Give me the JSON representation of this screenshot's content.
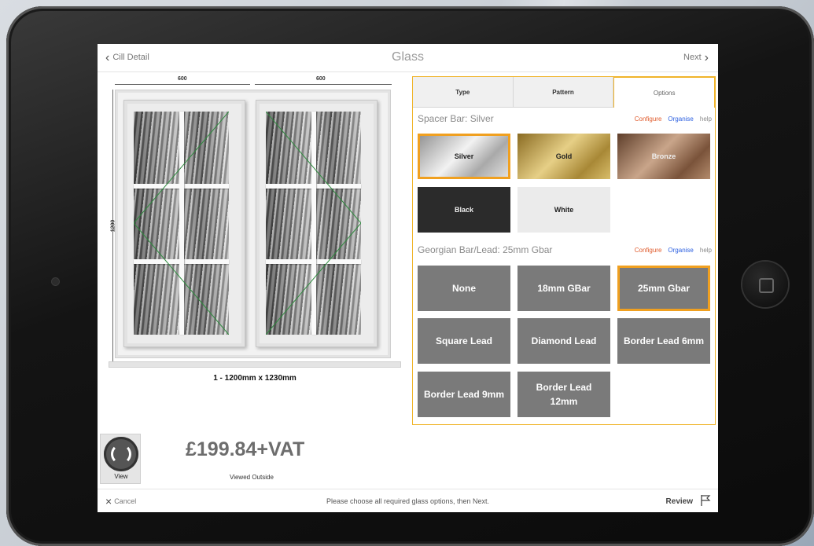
{
  "header": {
    "back_label": "Cill Detail",
    "title": "Glass",
    "next_label": "Next"
  },
  "drawing": {
    "width_left": "600",
    "width_right": "600",
    "height": "1200",
    "size_label": "1 - 1200mm x 1230mm"
  },
  "tabs": [
    {
      "label": "Type"
    },
    {
      "label": "Pattern"
    },
    {
      "label": "Options"
    }
  ],
  "active_tab": "Options",
  "spacer": {
    "title": "Spacer Bar: Silver",
    "configure": "Configure",
    "organise": "Organise",
    "help": "help",
    "options": [
      {
        "label": "Silver",
        "selected": true
      },
      {
        "label": "Gold",
        "selected": false
      },
      {
        "label": "Bronze",
        "selected": false
      },
      {
        "label": "Black",
        "selected": false
      },
      {
        "label": "White",
        "selected": false
      }
    ]
  },
  "georgian": {
    "title": "Georgian Bar/Lead: 25mm Gbar",
    "configure": "Configure",
    "organise": "Organise",
    "help": "help",
    "options": [
      {
        "label": "None",
        "selected": false
      },
      {
        "label": "18mm GBar",
        "selected": false
      },
      {
        "label": "25mm Gbar",
        "selected": true
      },
      {
        "label": "Square Lead",
        "selected": false
      },
      {
        "label": "Diamond Lead",
        "selected": false
      },
      {
        "label": "Border Lead 6mm",
        "selected": false
      },
      {
        "label": "Border Lead 9mm",
        "selected": false
      },
      {
        "label": "Border Lead 12mm",
        "selected": false
      }
    ]
  },
  "view": {
    "label": "View",
    "viewed_text": "Viewed Outside"
  },
  "price": "£199.84+VAT",
  "footer": {
    "cancel_label": "Cancel",
    "hint": "Please choose all required glass options, then Next.",
    "review_label": "Review"
  },
  "colors": {
    "accent": "#f0b42a",
    "option_bg": "#7a7a7a",
    "configure_link": "#e05a2b",
    "organise_link": "#2b5fe0"
  }
}
